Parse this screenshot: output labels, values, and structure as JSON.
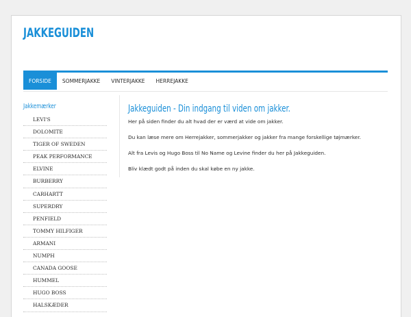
{
  "site": {
    "logo": "JAKKEGUIDEN"
  },
  "nav": {
    "items": [
      {
        "label": "FORSIDE",
        "active": true
      },
      {
        "label": "SOMMERJAKKE",
        "active": false
      },
      {
        "label": "VINTERJAKKE",
        "active": false
      },
      {
        "label": "HERREJAKKE",
        "active": false
      }
    ]
  },
  "sidebar": {
    "title": "Jakkemærker",
    "items": [
      "LEVI'S",
      "DOLOMITE",
      "TIGER OF SWEDEN",
      "PEAK PERFORMANCE",
      "ELVINE",
      "BURBERRY",
      "CARHARTT",
      "SUPERDRY",
      "PENFIELD",
      "TOMMY HILFIGER",
      "ARMANI",
      "NUMPH",
      "CANADA GOOSE",
      "HUMMEL",
      "HUGO BOSS",
      "HALSKÆDER"
    ]
  },
  "main": {
    "title": "Jakkeguiden - Din indgang til viden om jakker.",
    "paragraphs": [
      "Her på siden finder du alt hvad der er værd at vide om jakker.",
      "Du kan læse mere om Herrejakker, sommerjakker og jakker fra mange forskellige tøjmærker.",
      "Alt fra Levis og Hugo Boss til No Name og Levine finder du her på Jakkeguiden.",
      "Bliv klædt godt på inden du skal købe en ny jakke."
    ]
  },
  "colors": {
    "accent": "#1a8fd8",
    "text": "#2b2b2b",
    "background": "#f0f0f0"
  }
}
